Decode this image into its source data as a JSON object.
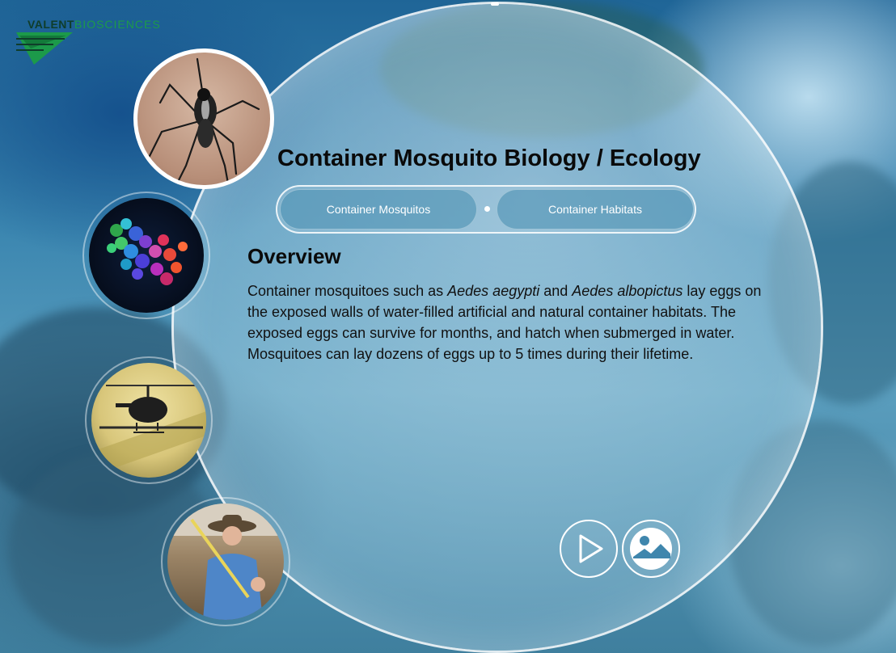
{
  "logo": {
    "part1": "VALENT",
    "part2": "BIOSCIENCES"
  },
  "title": "Container Mosquito Biology / Ecology",
  "tabs": [
    {
      "label": "Container Mosquitos"
    },
    {
      "label": "Container Habitats"
    }
  ],
  "overview": {
    "heading": "Overview",
    "text_1": "Container mosquitoes such as ",
    "species_1": "Aedes aegypti",
    "text_2": " and ",
    "species_2": "Aedes albopictus",
    "text_3": " lay eggs on the exposed walls of water-filled artificial and natural container habitats. The exposed eggs can survive for months, and hatch when submerged in water. Mosquitoes can lay dozens of eggs up to 5 times during their lifetime."
  },
  "thumbnails": [
    {
      "icon": "mosquito-icon"
    },
    {
      "icon": "molecule-icon"
    },
    {
      "icon": "helicopter-icon"
    },
    {
      "icon": "field-worker-icon"
    }
  ],
  "controls": {
    "play_icon": "play-icon",
    "gallery_icon": "image-gallery-icon"
  },
  "colors": {
    "accent_green": "#1c9a4a",
    "logo_dark": "#0f3d2a",
    "tab_bg": "#468caf"
  }
}
